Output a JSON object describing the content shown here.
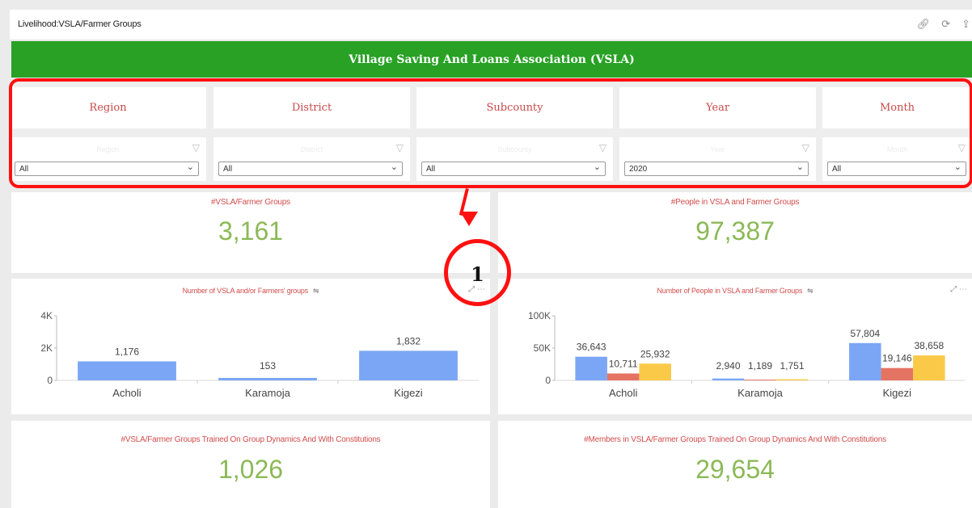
{
  "window": {
    "title": "Livelihood:VSLA/Farmer Groups",
    "tool_icons": [
      "link-icon",
      "refresh-icon",
      "share-icon"
    ]
  },
  "banner": {
    "title": "Village Saving And Loans Association (VSLA)",
    "color": "#28a125"
  },
  "filters": [
    {
      "label": "Region",
      "placeholder": "Region",
      "value": "All"
    },
    {
      "label": "District",
      "placeholder": "District",
      "value": "All"
    },
    {
      "label": "Subcounty",
      "placeholder": "Subcounty",
      "value": "All"
    },
    {
      "label": "Year",
      "placeholder": "Year",
      "value": "2020"
    },
    {
      "label": "Month",
      "placeholder": "Month",
      "value": "All"
    }
  ],
  "annotation": {
    "number": "1",
    "color": "#ff1010"
  },
  "kpis": {
    "vsla_groups": {
      "title": "#VSLA/Farmer Groups",
      "value": "3,161"
    },
    "people": {
      "title": "#People in VSLA and Farmer Groups",
      "value": "97,387"
    },
    "trained_groups": {
      "title": "#VSLA/Farmer Groups Trained On Group Dynamics And With Constitutions",
      "value": "1,026"
    },
    "trained_members": {
      "title": "#Members in VSLA/Farmer Groups Trained On Group Dynamics And With Constitutions",
      "value": "29,654"
    }
  },
  "chart_data": [
    {
      "type": "bar",
      "title": "Number of VSLA and/or Farmers' groups",
      "categories": [
        "Acholi",
        "Karamoja",
        "Kigezi"
      ],
      "values": [
        1176,
        153,
        1832
      ],
      "value_labels": [
        "1,176",
        "153",
        "1,832"
      ],
      "yticks": [
        "0",
        "2K",
        "4K"
      ],
      "ylim": [
        0,
        4000
      ],
      "color": "#7aa6f5"
    },
    {
      "type": "bar",
      "title": "Number of People in VSLA and Farmer Groups",
      "categories": [
        "Acholi",
        "Karamoja",
        "Kigezi"
      ],
      "series": [
        {
          "values": [
            36643,
            2940,
            57804
          ],
          "labels": [
            "36,643",
            "2,940",
            "57,804"
          ],
          "color": "#7aa6f5"
        },
        {
          "values": [
            10711,
            1189,
            19146
          ],
          "labels": [
            "10,711",
            "1,189",
            "19,146"
          ],
          "color": "#e57362"
        },
        {
          "values": [
            25932,
            1751,
            38658
          ],
          "labels": [
            "25,932",
            "1,751",
            "38,658"
          ],
          "color": "#fbc948"
        }
      ],
      "yticks": [
        "0",
        "50K",
        "100K"
      ],
      "ylim": [
        0,
        100000
      ]
    }
  ]
}
